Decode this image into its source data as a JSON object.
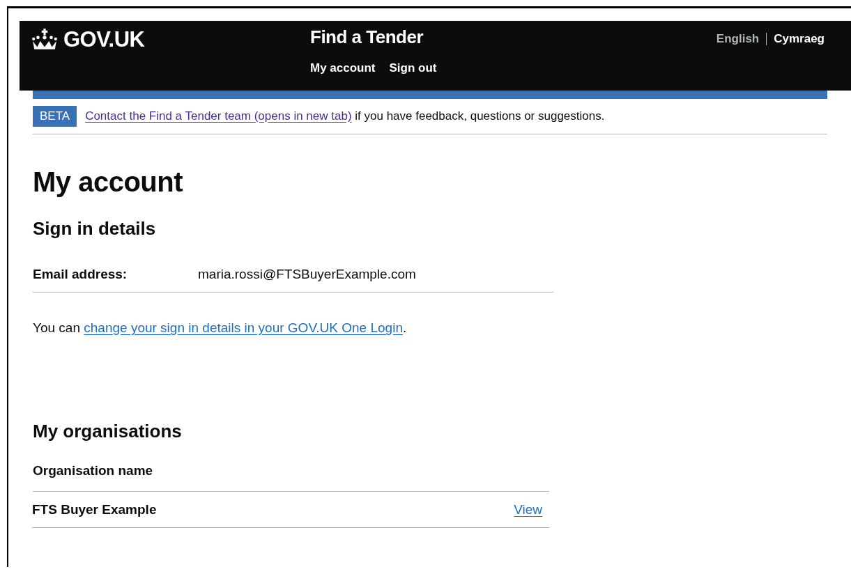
{
  "header": {
    "logo": "GOV.UK",
    "service": "Find a Tender",
    "nav": [
      "My account",
      "Sign out"
    ],
    "languages": [
      {
        "label": "English",
        "selected": true
      },
      {
        "label": "Cymraeg",
        "selected": false
      }
    ]
  },
  "phase_banner": {
    "tag": "BETA",
    "link": "Contact the Find a Tender team (opens in new tab)",
    "text": "if you have feedback, questions or suggestions."
  },
  "heading": "My account",
  "sign_in": {
    "heading": "Sign in details",
    "rows": [
      {
        "key": "Email address:",
        "value": "maria.rossi@FTSBuyerExample.com"
      }
    ],
    "prefix": "You can",
    "link": "change your sign in details in your GOV.UK One Login",
    "suffix": "."
  },
  "organisations": {
    "heading": "My organisations",
    "column": "Organisation name",
    "rows": [
      {
        "name": "FTS Buyer Example",
        "action": "View"
      }
    ]
  }
}
